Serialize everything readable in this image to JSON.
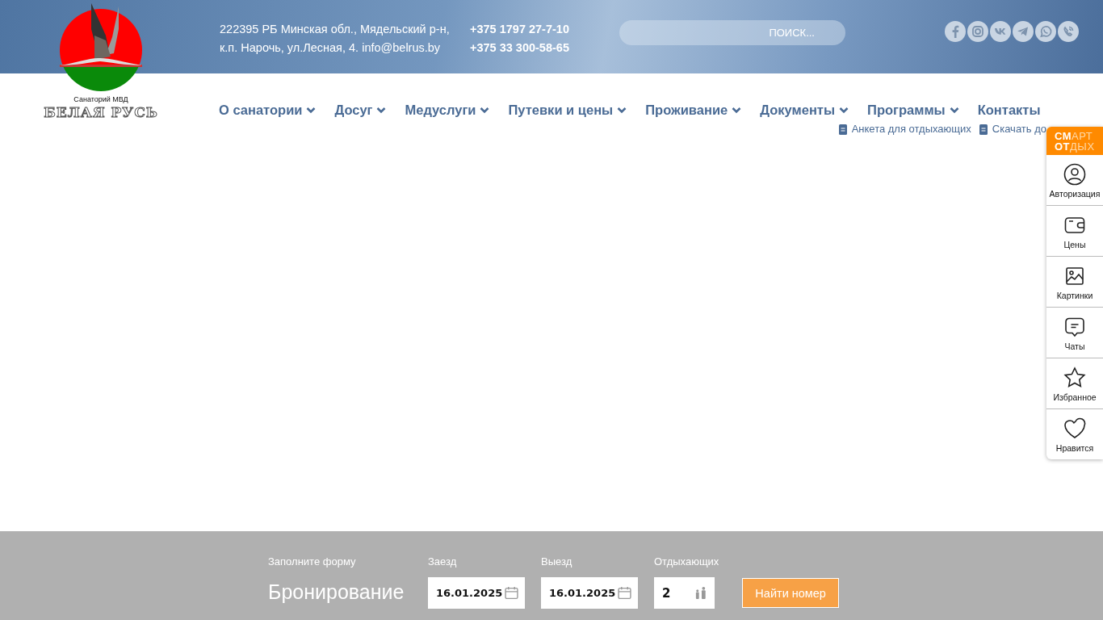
{
  "header": {
    "address_lines": [
      "222395 РБ Минская обл., Мядельский р-н,",
      "к.п. Нарочь, ул.Лесная, 4."
    ],
    "email": "info@belrus.by",
    "phones": [
      "+375 1797 27-7-10",
      "+375 33 300-58-65"
    ],
    "search": {
      "placeholder": "ПОИСК..."
    },
    "social": [
      {
        "kind": "facebook"
      },
      {
        "kind": "instagram"
      },
      {
        "kind": "vk"
      },
      {
        "kind": "telegram"
      },
      {
        "kind": "whatsapp"
      },
      {
        "kind": "viber"
      }
    ]
  },
  "logo": {
    "caption": "Санаторий  МВД",
    "name": "БЕЛАЯ РУСЬ"
  },
  "nav": [
    {
      "label": "О санатории",
      "has_dropdown": true
    },
    {
      "label": "Досуг",
      "has_dropdown": true
    },
    {
      "label": "Медуслуги",
      "has_dropdown": true
    },
    {
      "label": "Путевки и цены",
      "has_dropdown": true
    },
    {
      "label": "Проживание",
      "has_dropdown": true
    },
    {
      "label": "Документы",
      "has_dropdown": true
    },
    {
      "label": "Программы",
      "has_dropdown": true
    },
    {
      "label": "Контакты",
      "has_dropdown": false
    }
  ],
  "sub_links": [
    "Анкета для отдыхающих",
    "Скачать до"
  ],
  "widget": {
    "brand": [
      "**СМ**АРТ",
      "**ОТ**ДЫХ"
    ],
    "items": [
      {
        "kind": "user",
        "label": "Авторизация"
      },
      {
        "kind": "wallet",
        "label": "Цены"
      },
      {
        "kind": "image",
        "label": "Картинки"
      },
      {
        "kind": "chat",
        "label": "Чаты"
      },
      {
        "kind": "star",
        "label": "Избранное"
      },
      {
        "kind": "heart",
        "label": "Нравится"
      }
    ]
  },
  "booking": {
    "hint": "Заполните форму",
    "title": "Бронирование",
    "fields": [
      {
        "kind": "date",
        "label": "Заезд",
        "value": "16.01.2025"
      },
      {
        "kind": "date",
        "label": "Выезд",
        "value": "16.01.2025"
      },
      {
        "kind": "guests",
        "label": "Отдыхающих",
        "value": "2"
      }
    ],
    "button": "Найти номер"
  }
}
